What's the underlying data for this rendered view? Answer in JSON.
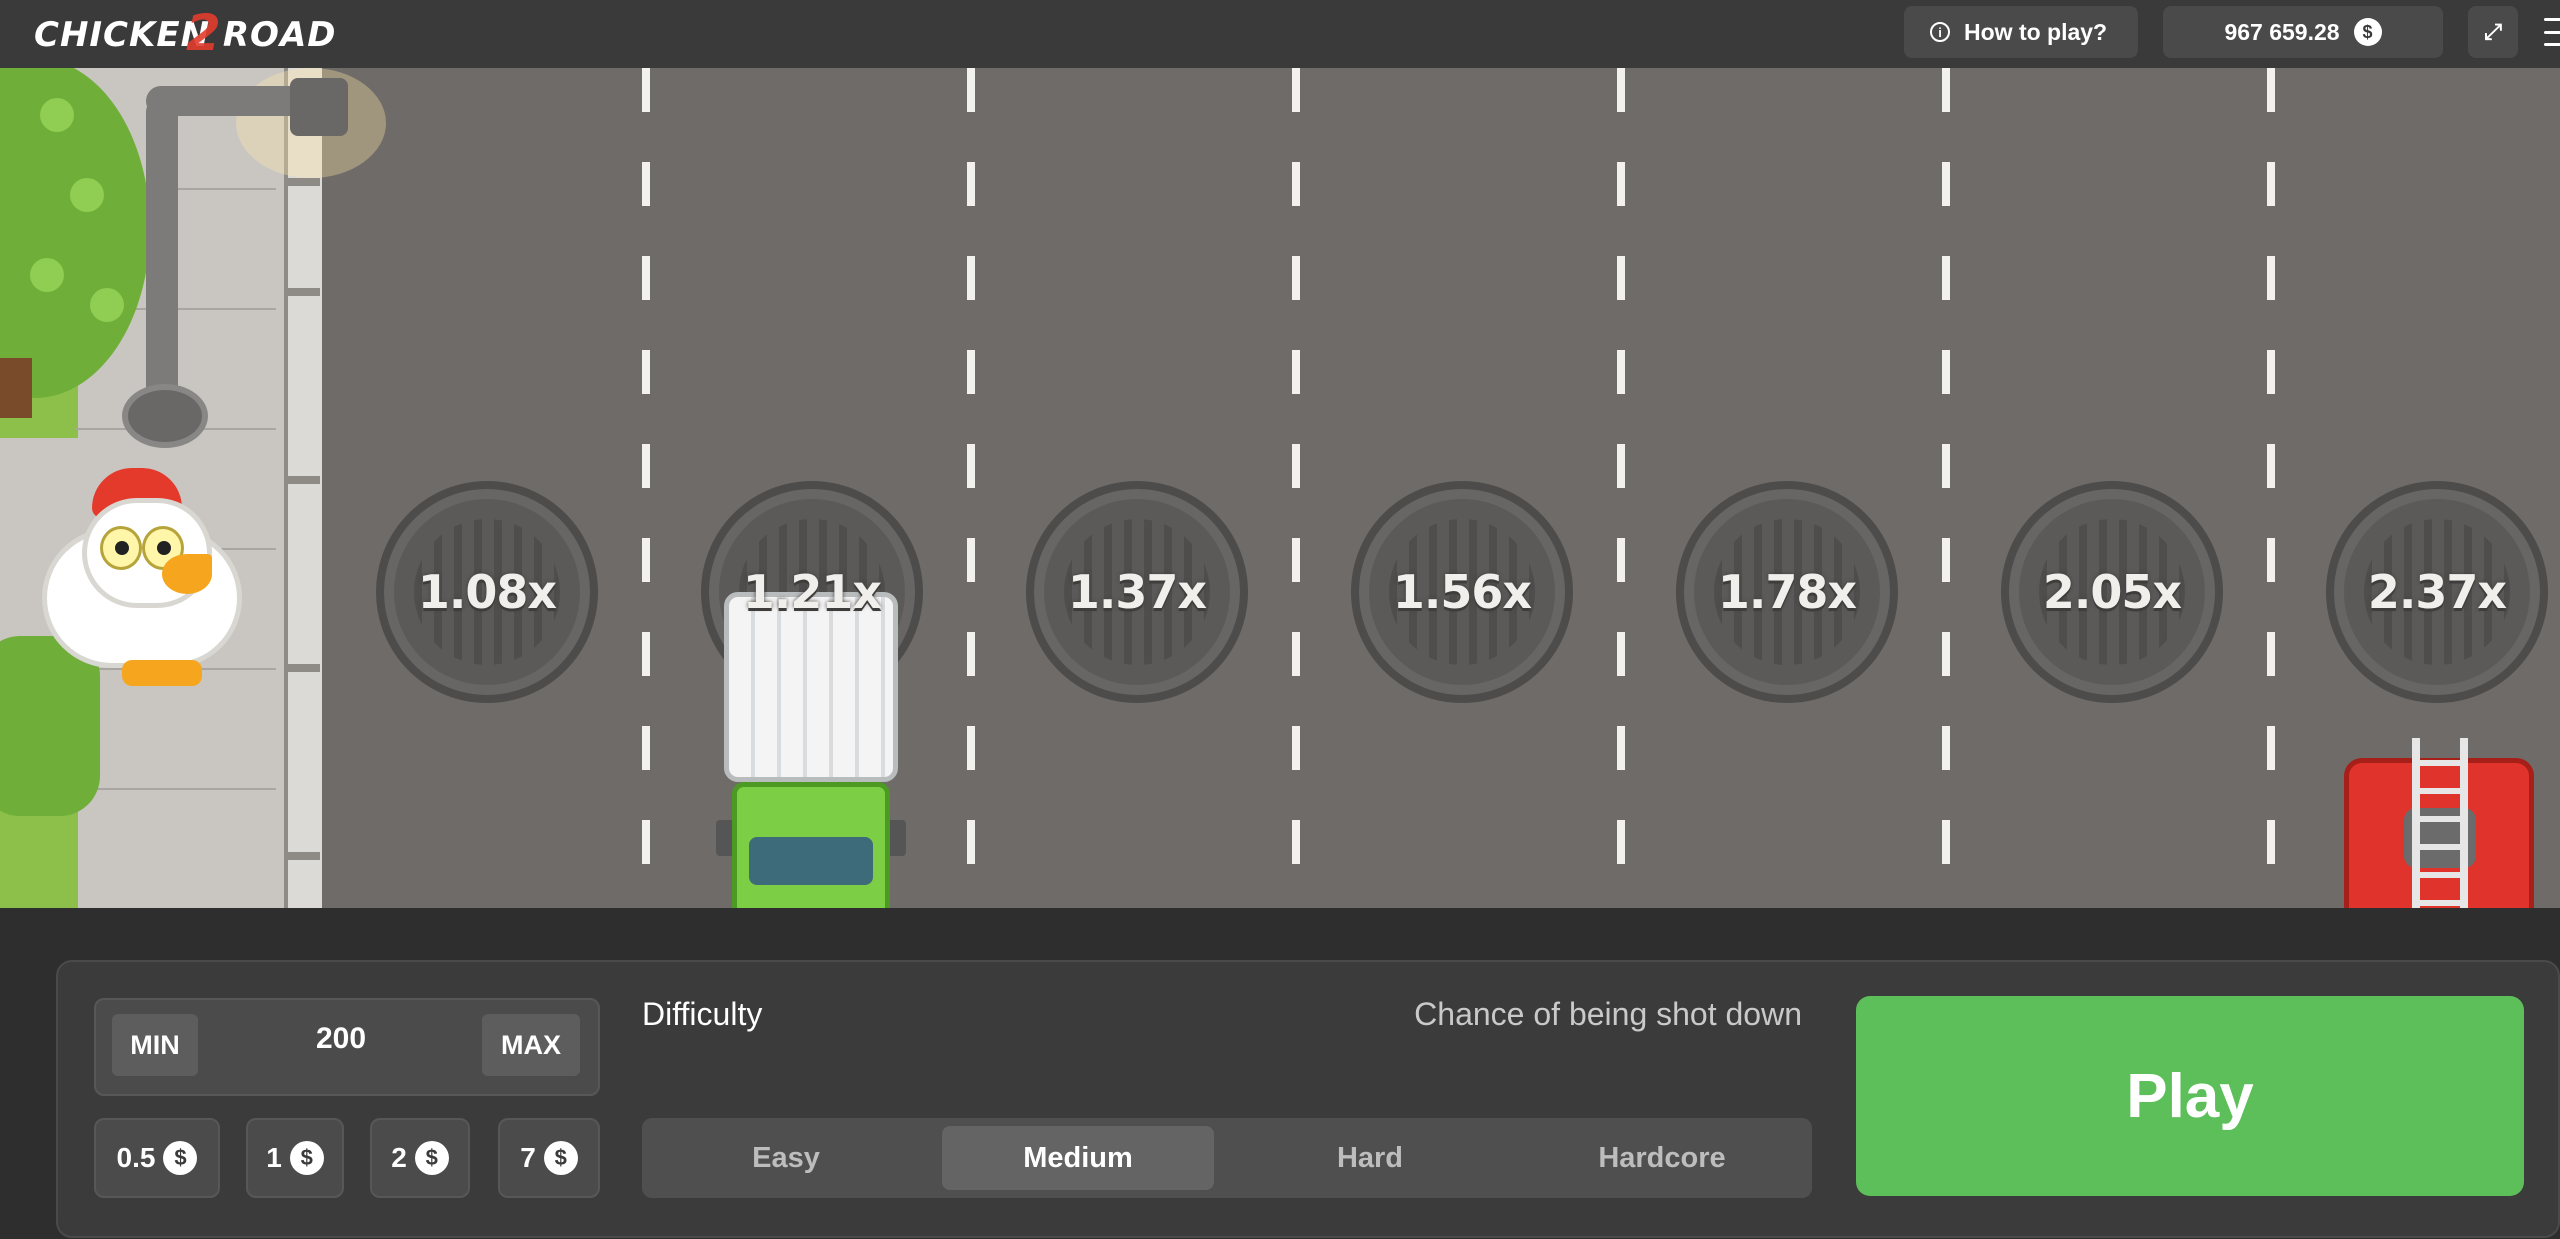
{
  "header": {
    "logo_text": "CHICKEN ROAD",
    "logo_number": "2",
    "how_to_play_label": "How to play?",
    "info_icon": "info-icon",
    "balance": "967 659.28",
    "currency_symbol": "$",
    "fullscreen_icon": "fullscreen-icon",
    "menu_icon": "menu-icon"
  },
  "game": {
    "multipliers": [
      "1.08x",
      "1.21x",
      "1.37x",
      "1.56x",
      "1.78x",
      "2.05x",
      "2.37x"
    ]
  },
  "controls": {
    "min_label": "MIN",
    "max_label": "MAX",
    "bet_amount": "200",
    "quick_bets": [
      "0.5",
      "1",
      "2",
      "7"
    ],
    "currency_symbol": "$",
    "difficulty_label": "Difficulty",
    "chance_label": "Chance of being shot down",
    "difficulty_options": [
      "Easy",
      "Medium",
      "Hard",
      "Hardcore"
    ],
    "selected_difficulty": "Medium",
    "play_label": "Play"
  },
  "colors": {
    "play_green": "#5cbf5a",
    "road_gray": "#6e6b68",
    "header_bg": "#3a3a3a"
  }
}
